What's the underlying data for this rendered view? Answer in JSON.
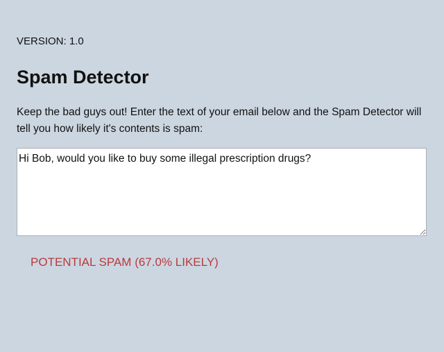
{
  "header": {
    "version_label": "VERSION: 1.0",
    "title": "Spam Detector"
  },
  "main": {
    "description": "Keep the bad guys out! Enter the text of your email below and the Spam Detector will tell you how likely it's contents is spam:",
    "email_input": {
      "value": "Hi Bob, would you like to buy some illegal prescription drugs?",
      "placeholder": ""
    },
    "result": {
      "text": "POTENTIAL SPAM (67.0% LIKELY)",
      "likelihood_percent": 67.0
    }
  },
  "colors": {
    "background": "#ccd6e1",
    "result_text": "#b83a3c",
    "input_border": "#a9aeb4"
  }
}
